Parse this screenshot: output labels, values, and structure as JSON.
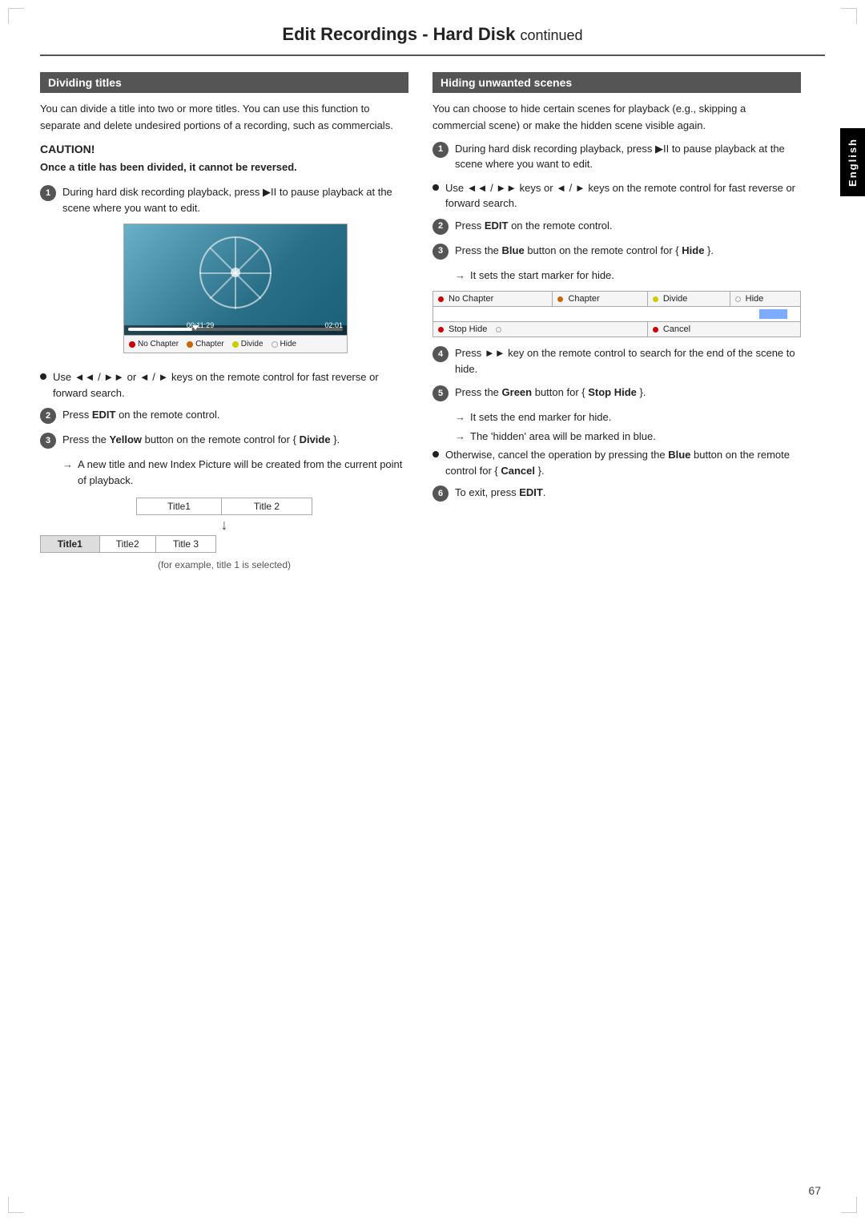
{
  "page": {
    "title": "Edit Recordings - Hard Disk",
    "title_continued": "continued",
    "page_number": "67",
    "english_tab": "English"
  },
  "left_section": {
    "header": "Dividing titles",
    "intro": "You can divide a title into two or more titles. You can use this function to separate and delete undesired portions of a recording, such as commercials.",
    "caution_title": "CAUTION!",
    "caution_bold": "Once a title has been divided, it cannot be reversed.",
    "step1": "During hard disk recording playback, press ▶II to pause playback at the scene where you want to edit.",
    "bullet1": "Use ◄◄ / ►► or ◄ / ► keys on the remote control for fast reverse or forward search.",
    "step2": "Press EDIT on the remote control.",
    "step3_pre": "Press the ",
    "step3_color": "Yellow",
    "step3_post": " button on the remote control for { ",
    "step3_bold": "Divide",
    "step3_end": " }.",
    "arrow1": "A new title and new Index Picture will be created from the current point of playback.",
    "example_caption": "(for example, title 1 is selected)",
    "chapter_items": [
      "No Chapter",
      "Chapter",
      "Divide",
      "Hide"
    ],
    "title_table_before": [
      [
        "Title1",
        "Title 2"
      ]
    ],
    "title_table_after": [
      [
        "Title1",
        "Title2",
        "Title 3"
      ]
    ]
  },
  "right_section": {
    "header": "Hiding unwanted scenes",
    "intro": "You can choose to hide certain scenes for playback (e.g., skipping a commercial scene) or make the hidden scene visible again.",
    "step1": "During hard disk recording playback, press ▶II to pause playback at the scene where you want to edit.",
    "bullet1": "Use ◄◄ / ►► keys or ◄ / ► keys on the remote control for fast reverse or forward search.",
    "step2": "Press EDIT on the remote control.",
    "step3_pre": "Press the ",
    "step3_color": "Blue",
    "step3_post": " button on the remote control for { ",
    "step3_bold": "Hide",
    "step3_end": " }.",
    "arrow1": "It sets the start marker for hide.",
    "hide_table_top": [
      "No Chapter",
      "Chapter",
      "Divide",
      "Hide"
    ],
    "hide_table_bottom_left": "Stop Hide",
    "hide_table_bottom_right": "Cancel",
    "step4": "Press ►► key on the remote control to search for the end of the scene to hide.",
    "step5_pre": "Press the ",
    "step5_color": "Green",
    "step5_post": " button for { ",
    "step5_bold": "Stop Hide",
    "step5_end": " }.",
    "arrow2": "It sets the end marker for hide.",
    "arrow3": "The 'hidden' area will be marked in blue.",
    "bullet2_pre": "Otherwise, cancel the operation by pressing the ",
    "bullet2_color": "Blue",
    "bullet2_post": " button on the remote control for { ",
    "bullet2_bold": "Cancel",
    "bullet2_end": " }.",
    "step6": "To exit, press EDIT."
  }
}
